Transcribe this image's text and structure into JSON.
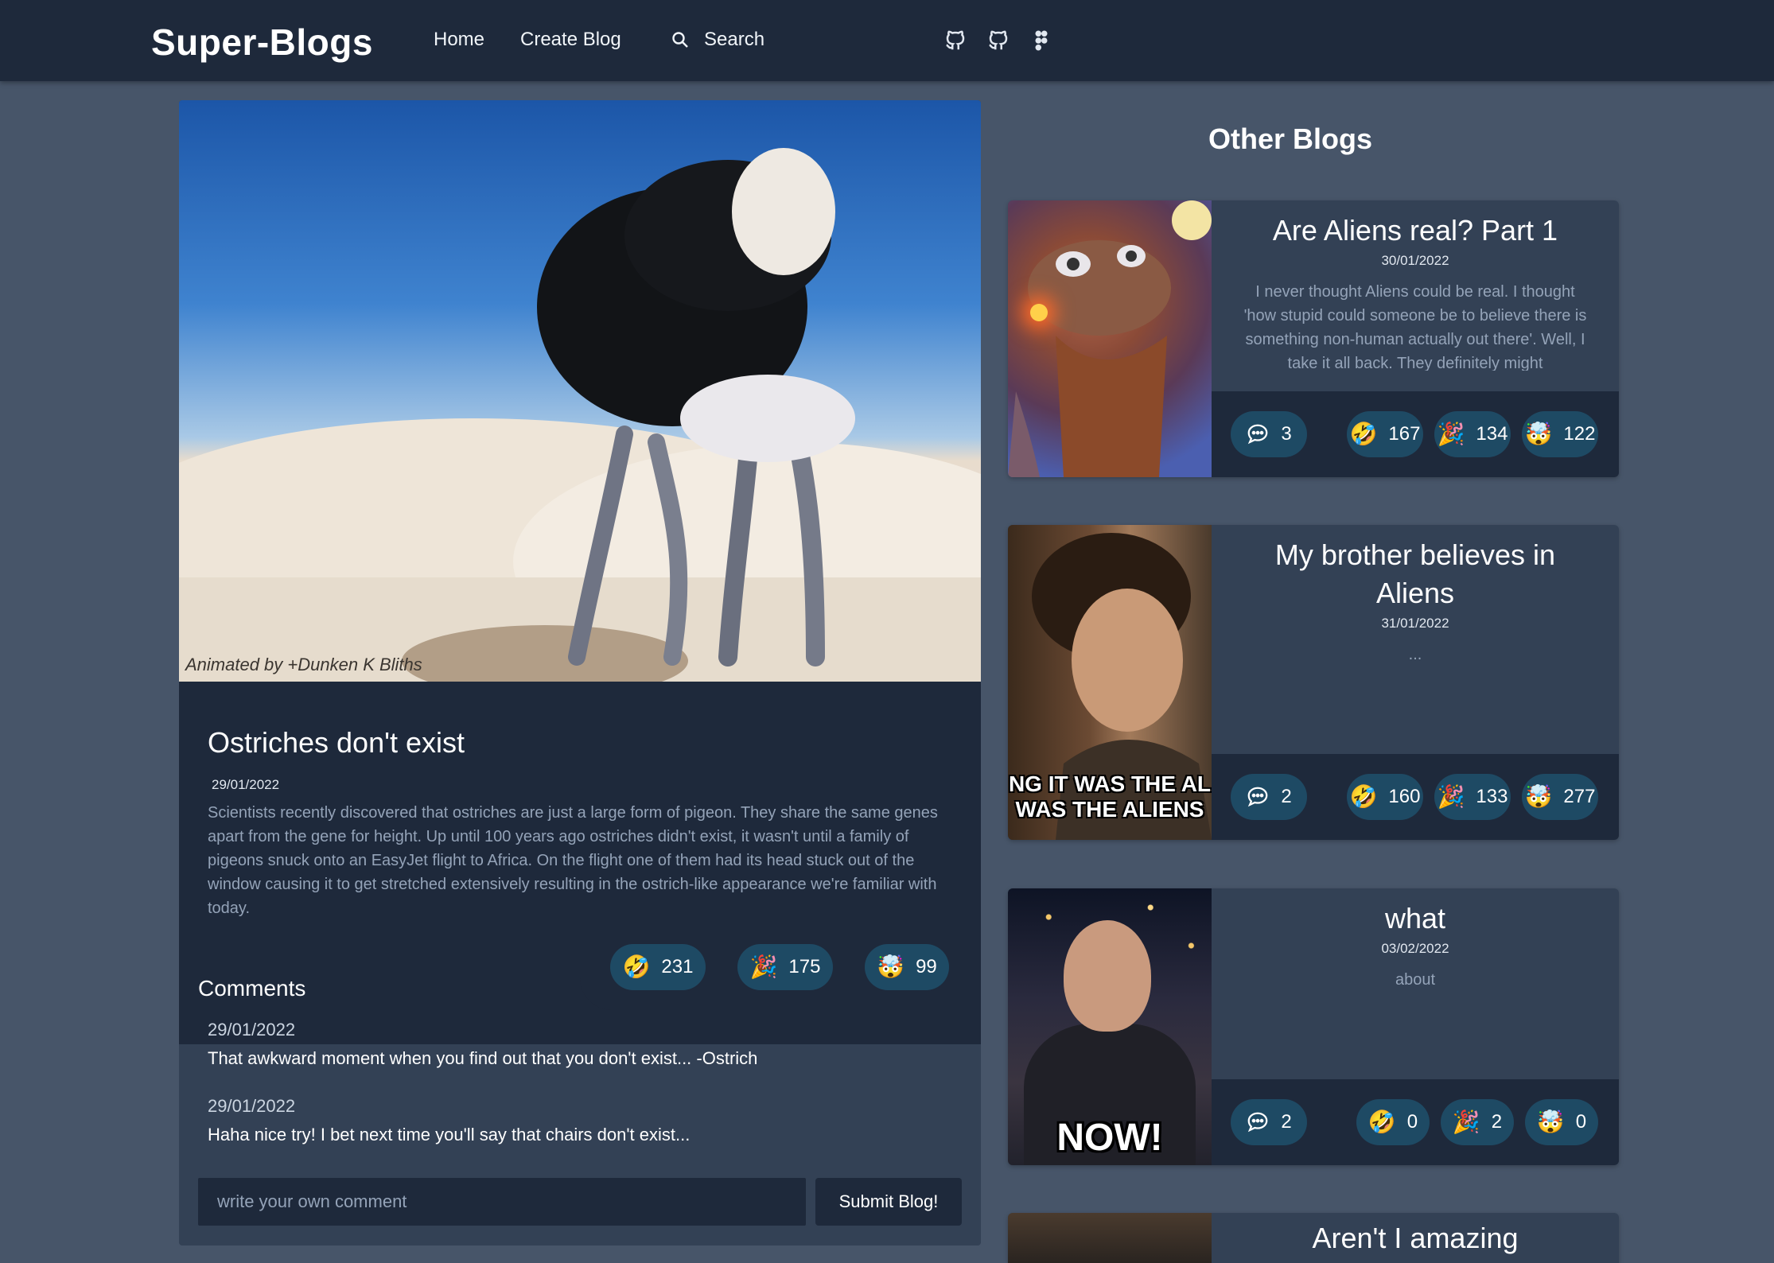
{
  "nav": {
    "brand": "Super-Blogs",
    "home": "Home",
    "create": "Create Blog",
    "search": "Search",
    "icons": [
      "github-icon",
      "github-icon",
      "figma-icon"
    ]
  },
  "post": {
    "image_credit": "Animated by +Dunken K Bliths",
    "title": "Ostriches don't exist",
    "date": "29/01/2022",
    "text": "Scientists recently discovered that ostriches are just a large form of pigeon. They share the same genes apart from the gene for height. Up until 100 years ago ostriches didn't exist, it wasn't until a family of pigeons snuck onto an EasyJet flight to Africa. On the flight one of them had its head stuck out of the window causing it to get stretched extensively resulting in the ostrich-like appearance we're familiar with today.",
    "reactions": [
      {
        "emoji": "🤣",
        "count": "231"
      },
      {
        "emoji": "🎉",
        "count": "175"
      },
      {
        "emoji": "🤯",
        "count": "99"
      }
    ]
  },
  "comments": {
    "title": "Comments",
    "items": [
      {
        "date": "29/01/2022",
        "text": "That awkward moment when you find out that you don't exist... -Ostrich"
      },
      {
        "date": "29/01/2022",
        "text": "Haha nice try! I bet next time you'll say that chairs don't exist..."
      }
    ],
    "placeholder": "write your own comment",
    "submit": "Submit Blog!"
  },
  "sidebar": {
    "title": "Other Blogs",
    "cards": [
      {
        "title": "Are Aliens real? Part 1",
        "date": "30/01/2022",
        "excerpt": "I never thought Aliens could be real. I thought 'how stupid could someone be to believe there is something non-human actually out there'. Well, I take it all back. They definitely might",
        "comments": "3",
        "reactions": [
          "167",
          "134",
          "122"
        ]
      },
      {
        "title": "My brother believes in Aliens",
        "date": "31/01/2022",
        "excerpt": "...",
        "comments": "2",
        "reactions": [
          "160",
          "133",
          "277"
        ],
        "thumb_caption_1": "NG IT WAS THE AL",
        "thumb_caption_2": "WAS THE ALIENS"
      },
      {
        "title": "what",
        "date": "03/02/2022",
        "excerpt": "about",
        "comments": "2",
        "reactions": [
          "0",
          "2",
          "0"
        ],
        "thumb_caption": "NOW!"
      },
      {
        "title": "Aren't I amazing"
      }
    ]
  },
  "reaction_emojis": [
    "🤣",
    "🎉",
    "🤯"
  ],
  "colors": {
    "page_bg": "#475569",
    "nav_bg": "#1e293b",
    "card_bg": "#334155",
    "pill_bg": "#1e4a64",
    "muted_text": "#94a3b8"
  }
}
